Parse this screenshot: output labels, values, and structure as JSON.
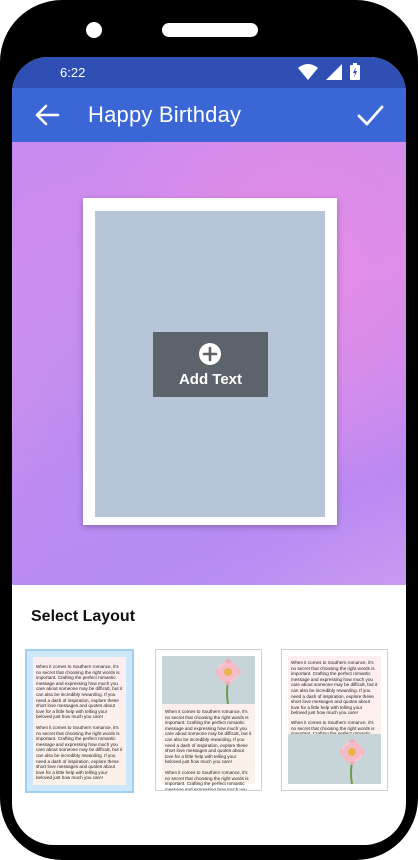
{
  "status": {
    "time": "6:22"
  },
  "appbar": {
    "title": "Happy Birthday"
  },
  "editor": {
    "add_text_label": "Add Text"
  },
  "layout": {
    "section_title": "Select Layout",
    "sample_text_1": "When it comes to Southern romance, it's no secret that choosing the right words is important. Crafting the perfect romantic message and expressing how much you care about someone may be difficult, but it can also be incredibly rewarding. If you need a dash of inspiration, explore these short love messages and quotes about love for a little help with telling your beloved just how much you care!",
    "sample_text_2": "When it comes to Southern romance, it's no secret that choosing the right words is important. Crafting the perfect romantic message and expressing how much you care about someone may be difficult, but it can also be incredibly rewarding. If you need a dash of inspiration, explore these short love messages and quotes about love for a little help with telling your beloved just how much you care!",
    "sample_text_3": "When it comes to Southern romance, it's no secret that choosing the right words is important. Crafting the perfect romantic message and expressing how much you care about someone may be difficult, but it can also be incredibly rewarding. If you need a dash of inspiration, explore these short love messages and quotes about love for a little help with telling your beloved just how much you care!",
    "sample_text_4": "When it comes to Southern romance, it's no secret that choosing the right words is important. Crafting the perfect romantic message and expressing how much you care about someone may be difficult, but it can also be incredibly rewarding. If you need a dash of inspiration, explore these short love",
    "sample_text_5": "When it comes to Southern romance, it's no secret that choosing the right words is important. Crafting the perfect romantic message and expressing how much you care about someone may be difficult, but it can also be incredibly rewarding. If you need a dash of inspiration, explore these short love messages and quotes about love for a little help with telling your beloved just how much you care!",
    "sample_text_6": "When it comes to Southern romance, it's no secret that choosing the right words is important. Crafting the perfect romantic message and expressing how much you care about someone may be difficult, but it can also be incredibly rewarding. If you need a dash of inspiration, explore these short love messages and quotes about love for a little help with telling your beloved just how much you care!",
    "selected_index": 0
  },
  "colors": {
    "statusbar": "#2f4fb4",
    "appbar": "#3b67d6",
    "photo_placeholder": "#b6c6d8",
    "selected_border": "#9fd0f0"
  },
  "icons": [
    "wifi-icon",
    "signal-icon",
    "battery-icon",
    "back-arrow-icon",
    "check-icon",
    "plus-circle-icon",
    "flower-image"
  ]
}
